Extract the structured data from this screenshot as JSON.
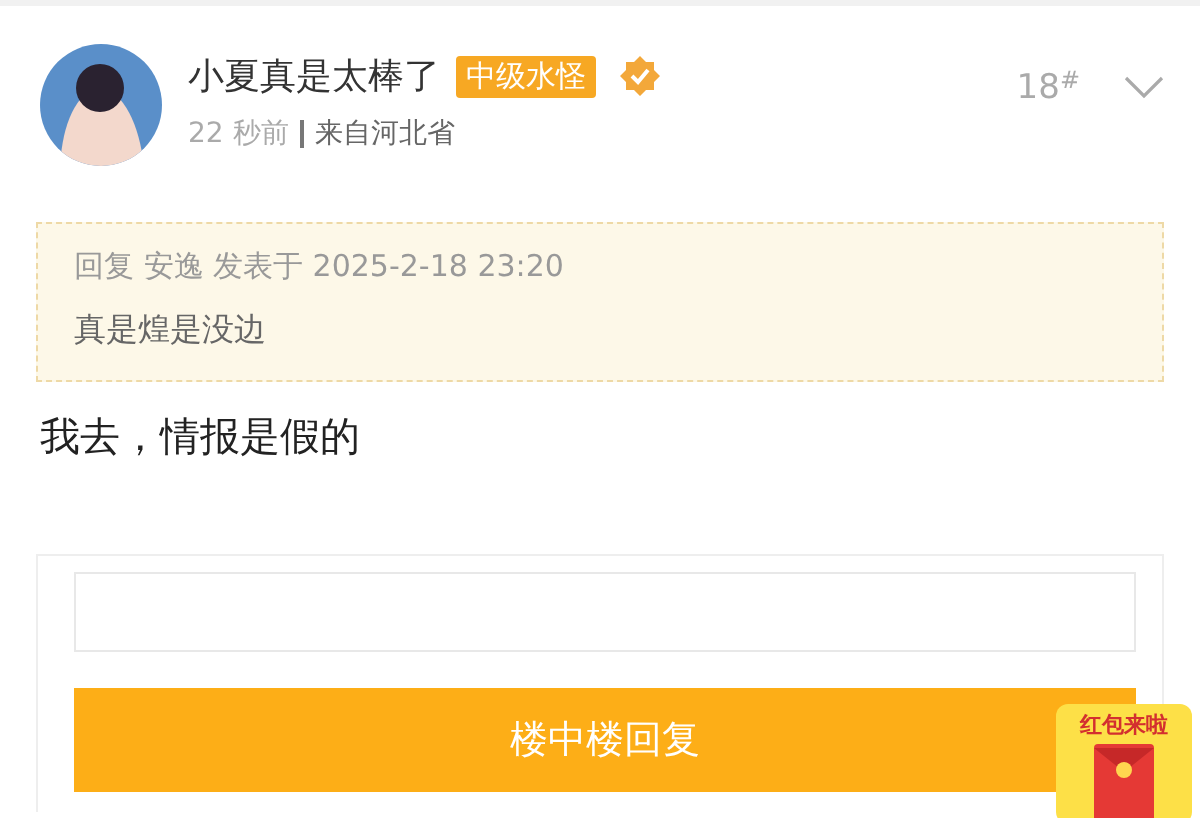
{
  "post": {
    "author": "小夏真是太棒了",
    "level_badge": "中级水怪",
    "verified": true,
    "floor": "18",
    "floor_mark": "#",
    "time": "22 秒前",
    "location": "来自河北省"
  },
  "quote": {
    "header": "回复 安逸 发表于 2025-2-18 23:20",
    "text": "真是煌是没边"
  },
  "content": "我去，情报是假的",
  "reply_box": {
    "button": "楼中楼回复"
  },
  "red_packet": {
    "label": "红包来啦"
  }
}
